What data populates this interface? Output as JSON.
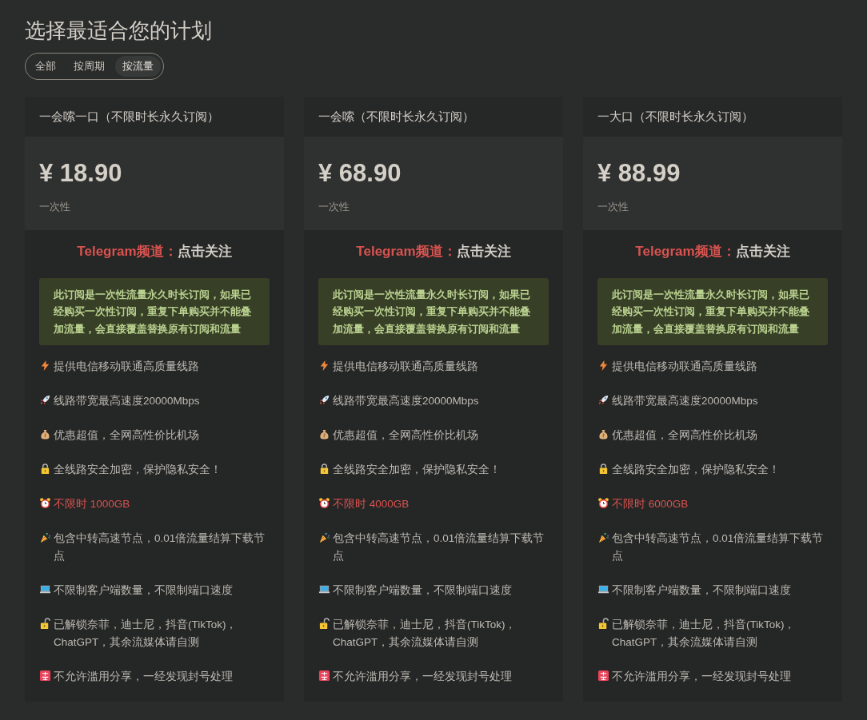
{
  "title": "选择最适合您的计划",
  "tabs": [
    {
      "label": "全部",
      "selected": false
    },
    {
      "label": "按周期",
      "selected": false
    },
    {
      "label": "按流量",
      "selected": true
    }
  ],
  "plans": [
    {
      "name": "一会嗦一口（不限时长永久订阅）",
      "price": "¥ 18.90",
      "period": "一次性",
      "channel": {
        "label": "Telegram频道：",
        "link": "点击关注"
      },
      "notice": "此订阅是一次性流量永久时长订阅，如果已经购买一次性订阅，重复下单购买并不能叠加流量，会直接覆盖替换原有订阅和流量",
      "features": [
        {
          "text": "提供电信移动联通高质量线路",
          "kind": "plain"
        },
        {
          "text": "线路带宽最高速度20000Mbps",
          "kind": "plain"
        },
        {
          "text": "优惠超值，全网高性价比机场",
          "kind": "plain"
        },
        {
          "text": "全线路安全加密，保护隐私安全！",
          "kind": "plain"
        },
        {
          "text": "不限时 1000GB",
          "kind": "quota"
        },
        {
          "text": "包含中转高速节点，0.01倍流量结算下载节点",
          "kind": "plain"
        },
        {
          "text": "不限制客户端数量，不限制端口速度",
          "kind": "plain"
        },
        {
          "text": "已解锁奈菲，迪士尼，抖音(TikTok)，ChatGPT，其余流媒体请自测",
          "kind": "plain"
        },
        {
          "text": "不允许滥用分享，一经发现封号处理",
          "kind": "plain"
        }
      ]
    },
    {
      "name": "一会嗦（不限时长永久订阅）",
      "price": "¥ 68.90",
      "period": "一次性",
      "channel": {
        "label": "Telegram频道：",
        "link": "点击关注"
      },
      "notice": "此订阅是一次性流量永久时长订阅，如果已经购买一次性订阅，重复下单购买并不能叠加流量，会直接覆盖替换原有订阅和流量",
      "features": [
        {
          "text": "提供电信移动联通高质量线路",
          "kind": "plain"
        },
        {
          "text": "线路带宽最高速度20000Mbps",
          "kind": "plain"
        },
        {
          "text": "优惠超值，全网高性价比机场",
          "kind": "plain"
        },
        {
          "text": "全线路安全加密，保护隐私安全！",
          "kind": "plain"
        },
        {
          "text": "不限时 4000GB",
          "kind": "quota"
        },
        {
          "text": "包含中转高速节点，0.01倍流量结算下载节点",
          "kind": "plain"
        },
        {
          "text": "不限制客户端数量，不限制端口速度",
          "kind": "plain"
        },
        {
          "text": "已解锁奈菲，迪士尼，抖音(TikTok)，ChatGPT，其余流媒体请自测",
          "kind": "plain"
        },
        {
          "text": "不允许滥用分享，一经发现封号处理",
          "kind": "plain"
        }
      ]
    },
    {
      "name": "一大口（不限时长永久订阅）",
      "price": "¥ 88.99",
      "period": "一次性",
      "channel": {
        "label": "Telegram频道：",
        "link": "点击关注"
      },
      "notice": "此订阅是一次性流量永久时长订阅，如果已经购买一次性订阅，重复下单购买并不能叠加流量，会直接覆盖替换原有订阅和流量",
      "features": [
        {
          "text": "提供电信移动联通高质量线路",
          "kind": "plain"
        },
        {
          "text": "线路带宽最高速度20000Mbps",
          "kind": "plain"
        },
        {
          "text": "优惠超值，全网高性价比机场",
          "kind": "plain"
        },
        {
          "text": "全线路安全加密，保护隐私安全！",
          "kind": "plain"
        },
        {
          "text": "不限时 6000GB",
          "kind": "quota"
        },
        {
          "text": "包含中转高速节点，0.01倍流量结算下载节点",
          "kind": "plain"
        },
        {
          "text": "不限制客户端数量，不限制端口速度",
          "kind": "plain"
        },
        {
          "text": "已解锁奈菲，迪士尼，抖音(TikTok)，ChatGPT，其余流媒体请自测",
          "kind": "plain"
        },
        {
          "text": "不允许滥用分享，一经发现封号处理",
          "kind": "plain"
        }
      ]
    }
  ]
}
